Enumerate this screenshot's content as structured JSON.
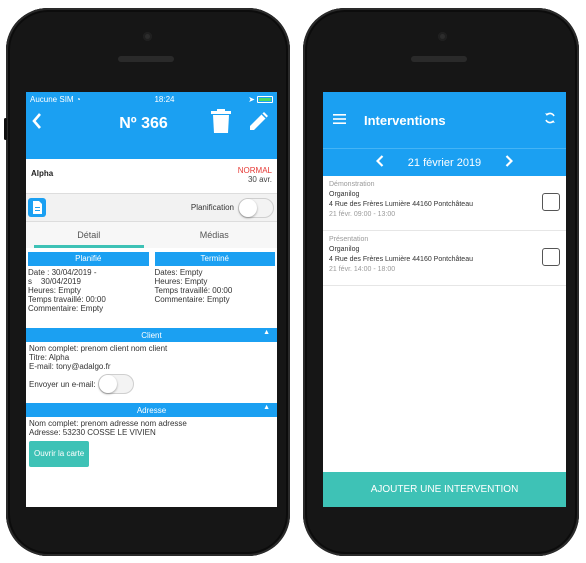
{
  "left_screen": {
    "status": {
      "carrier": "Aucune SIM",
      "time": "18:24"
    },
    "navbar": {
      "title": "Nº 366"
    },
    "card": {
      "name": "Alpha",
      "priority": "NORMAL",
      "date": "30 avr."
    },
    "planification_label": "Planification",
    "tabs": [
      "Détail",
      "Médias"
    ],
    "detail": {
      "planned": {
        "header": "Planifié",
        "lines": [
          "Date : 30/04/2019 -",
          "s    30/04/2019",
          "Heures: Empty",
          "Temps travaillé: 00:00",
          "Commentaire: Empty"
        ]
      },
      "done": {
        "header": "Terminé",
        "lines": [
          "Dates: Empty",
          "Heures: Empty",
          "Temps travaillé: 00:00",
          "Commentaire: Empty"
        ]
      }
    },
    "client": {
      "header": "Client",
      "lines": [
        "Nom complet: prenom client nom client",
        "Titre: Alpha",
        "E-mail: tony@adalgo.fr"
      ],
      "send_email_label": "Envoyer un e-mail:"
    },
    "address": {
      "header": "Adresse",
      "lines": [
        "Nom complet: prenom adresse nom adresse",
        "Adresse: 53230 COSSE LE VIVIEN"
      ],
      "map_button": "Ouvrir la carte"
    }
  },
  "right_screen": {
    "header_title": "Interventions",
    "date_label": "21 février 2019",
    "items": [
      {
        "type": "Démonstration",
        "company": "Organilog",
        "address": "4 Rue des Frères Lumière 44160 Pontchâteau",
        "when": "21 févr. 09:00 - 13:00"
      },
      {
        "type": "Présentation",
        "company": "Organilog",
        "address": "4 Rue des Frères Lumière 44160 Pontchâteau",
        "when": "21 févr. 14:00 - 18:00"
      }
    ],
    "add_button": "AJOUTER UNE INTERVENTION"
  },
  "colors": {
    "primary": "#1ba0f2",
    "accent": "#3ec2b6",
    "priority": "#e53935"
  }
}
